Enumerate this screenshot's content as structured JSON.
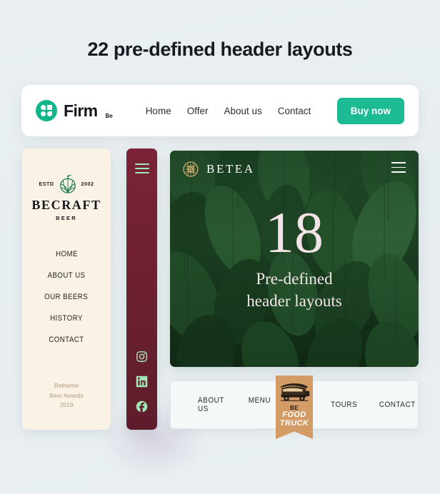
{
  "page": {
    "title": "22 pre-defined header layouts",
    "background_color": "#eaf0f2"
  },
  "firm_header": {
    "logo_name": "Firm",
    "logo_superscript": "Be",
    "logo_icon": "four-squares-icon",
    "accent_color": "#1dbb94",
    "nav": [
      {
        "label": "Home"
      },
      {
        "label": "Offer"
      },
      {
        "label": "About us"
      },
      {
        "label": "Contact"
      }
    ],
    "cta": {
      "label": "Buy now"
    }
  },
  "becraft_header": {
    "estd_left": "ESTD",
    "estd_right": "2002",
    "brand": "BECRAFT",
    "brand_sub": "BEER",
    "logo_icon": "hop-cone-icon",
    "background_color": "#fbf2e6",
    "menu": [
      {
        "label": "HOME"
      },
      {
        "label": "ABOUT US"
      },
      {
        "label": "OUR BEERS"
      },
      {
        "label": "HISTORY"
      },
      {
        "label": "CONTACT"
      }
    ],
    "footer": {
      "line1": "Betheme",
      "line2": "Beer Awards",
      "line3": "2019",
      "color": "#b09a7f"
    }
  },
  "maroon_sidebar": {
    "background_color": "#6b2030",
    "icon_color": "#9fe8b4",
    "menu_icon": "hamburger-icon",
    "socials": [
      {
        "name": "instagram-icon"
      },
      {
        "name": "linkedin-icon"
      },
      {
        "name": "facebook-icon"
      }
    ]
  },
  "betea_header": {
    "brand": "BETEA",
    "logo_icon": "celtic-knot-icon",
    "logo_color": "#c8a96a",
    "menu_icon": "hamburger-icon",
    "hero_number": "18",
    "hero_line1": "Pre-defined",
    "hero_line2": "header layouts",
    "text_color": "#f3e3e8"
  },
  "foodtruck_header": {
    "background_color": "#f4f8f9",
    "banner_color": "#d39c66",
    "truck_icon": "food-truck-icon",
    "nav_left": [
      {
        "label": "ABOUT US"
      },
      {
        "label": "MENU"
      }
    ],
    "nav_right": [
      {
        "label": "TOURS"
      },
      {
        "label": "CONTACT"
      }
    ],
    "badge": {
      "line1": "BE",
      "line2": "FOOD",
      "line3": "TRUCK"
    }
  }
}
